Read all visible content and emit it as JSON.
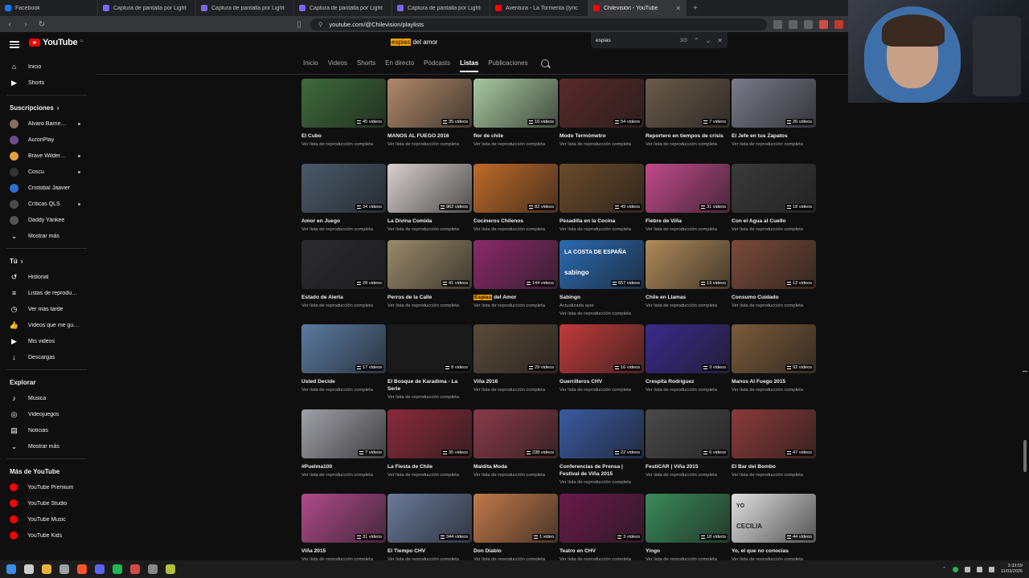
{
  "browser": {
    "tabs": [
      {
        "label": "Facebook",
        "color": "#1877f2",
        "active": false
      },
      {
        "label": "Captura de pantalla por Lightshot",
        "color": "#7b68ee",
        "active": false
      },
      {
        "label": "Captura de pantalla por Lightshot",
        "color": "#7b68ee",
        "active": false
      },
      {
        "label": "Captura de pantalla por Lightshot",
        "color": "#7b68ee",
        "active": false
      },
      {
        "label": "Captura de pantalla por Lightshot",
        "color": "#7b68ee",
        "active": false
      },
      {
        "label": "Aventura - La Tormenta (lyric - letra)",
        "color": "#ff0000",
        "active": false
      },
      {
        "label": "Chilevisión - YouTube",
        "color": "#ff0000",
        "active": true
      }
    ],
    "url": "youtube.com/@Chilevision/playlists",
    "find": {
      "query": "espias",
      "count": "3/3"
    }
  },
  "youtube": {
    "logo_text": "YouTube",
    "country_code": "CL",
    "search_highlight": "espias",
    "search_rest": " del amor",
    "channel_tabs": [
      "Inicio",
      "Videos",
      "Shorts",
      "En directo",
      "Pódcasts",
      "Listas",
      "Publicaciones"
    ],
    "active_tab": "Listas"
  },
  "sidebar": {
    "main": [
      {
        "label": "Inicio",
        "icon": "home-icon",
        "glyph": "⌂"
      },
      {
        "label": "Shorts",
        "icon": "shorts-icon",
        "glyph": "▶"
      }
    ],
    "subscriptions_title": "Suscripciones",
    "subscriptions": [
      {
        "label": "Alvaro Barriento...",
        "color": "#8a6d5a",
        "dot": true
      },
      {
        "label": "AuronPlay",
        "color": "#6d4c8a",
        "dot": false
      },
      {
        "label": "Brave Wilderness",
        "color": "#e2a03a",
        "dot": true
      },
      {
        "label": "Coscu",
        "color": "#333333",
        "dot": true
      },
      {
        "label": "Cristobal Jaavier",
        "color": "#2e6fd1",
        "dot": false
      },
      {
        "label": "Críticas QLS",
        "color": "#4a4a4a",
        "dot": true
      },
      {
        "label": "Daddy Yankee",
        "color": "#555555",
        "dot": false
      }
    ],
    "show_more": "Mostrar más",
    "you_title": "Tú",
    "you": [
      {
        "label": "Historial",
        "icon": "history-icon",
        "glyph": "↺"
      },
      {
        "label": "Listas de reproducc...",
        "icon": "playlists-icon",
        "glyph": "≡"
      },
      {
        "label": "Ver más tarde",
        "icon": "watch-later-icon",
        "glyph": "◷"
      },
      {
        "label": "Videos que me gus...",
        "icon": "liked-icon",
        "glyph": "👍"
      },
      {
        "label": "Mis videos",
        "icon": "my-videos-icon",
        "glyph": "▶"
      },
      {
        "label": "Descargas",
        "icon": "downloads-icon",
        "glyph": "↓"
      }
    ],
    "explore_title": "Explorar",
    "explore": [
      {
        "label": "Música",
        "icon": "music-icon",
        "glyph": "♪"
      },
      {
        "label": "Videojuegos",
        "icon": "gaming-icon",
        "glyph": "◎"
      },
      {
        "label": "Noticias",
        "icon": "news-icon",
        "glyph": "▤"
      }
    ],
    "explore_more": "Mostrar más",
    "more_title": "Más de YouTube",
    "more": [
      {
        "label": "YouTube Premium"
      },
      {
        "label": "YouTube Studio"
      },
      {
        "label": "YouTube Music"
      },
      {
        "label": "YouTube Kids"
      }
    ]
  },
  "playlists": [
    [
      {
        "title": "El Cubo",
        "count": "45 videos",
        "sub": "Ver lista de reproducción completa",
        "color": "#3d6b3a"
      },
      {
        "title": "MANOS AL FUEGO 2016",
        "count": "35 videos",
        "sub": "Ver lista de reproducción completa",
        "color": "#b08a6a"
      },
      {
        "title": "flor de chile",
        "count": "16 videos",
        "sub": "Ver lista de reproducción completa",
        "color": "#a8c8a0"
      },
      {
        "title": "Modo Termómetro",
        "count": "54 videos",
        "sub": "Ver lista de reproducción completa",
        "color": "#5a2a2a"
      },
      {
        "title": "Reportero en tiempos de crisis",
        "count": "7 videos",
        "sub": "Ver lista de reproducción completa",
        "color": "#6a5a4a"
      },
      {
        "title": "El Jefe en tus Zapatos",
        "count": "26 videos",
        "sub": "Ver lista de reproducción completa",
        "color": "#7a7a8a"
      }
    ],
    [
      {
        "title": "Amor en Juego",
        "count": "34 videos",
        "sub": "Ver lista de reproducción completa",
        "color": "#4a5a6a"
      },
      {
        "title": "La Divina Comida",
        "count": "962 videos",
        "sub": "Ver lista de reproducción completa",
        "color": "#d8d0d0"
      },
      {
        "title": "Cocineros Chilenos",
        "count": "82 videos",
        "sub": "Ver lista de reproducción completa",
        "color": "#c06a2a"
      },
      {
        "title": "Pesadilla en la Cocina",
        "count": "49 videos",
        "sub": "Ver lista de reproducción completa",
        "color": "#6a4a2a"
      },
      {
        "title": "Fiebre de Viña",
        "count": "31 videos",
        "sub": "Ver lista de reproducción completa",
        "color": "#c04a8a"
      },
      {
        "title": "Con el Agua al Cuello",
        "count": "18 videos",
        "sub": "Ver lista de reproducción completa",
        "color": "#3a3a3a"
      }
    ],
    [
      {
        "title": "Estado de Alerta",
        "count": "28 videos",
        "sub": "Ver lista de reproducción completa",
        "color": "#2a2a30"
      },
      {
        "title": "Perros de la Calle",
        "count": "41 videos",
        "sub": "Ver lista de reproducción completa",
        "color": "#9a8a6a"
      },
      {
        "title": "Espías del Amor",
        "title_hl": "Espías",
        "title_rest": " del Amor",
        "count": "144 videos",
        "sub": "Ver lista de reproducción completa",
        "color": "#8a2a6a"
      },
      {
        "title": "Sabingo",
        "count": "657 videos",
        "sub": "Actualizada ayer",
        "sub2": "Ver lista de reproducción completa",
        "color": "#2a6ab0",
        "overlay_top": "LA COSTA DE ESPAÑA",
        "overlay_bottom": "sabingo"
      },
      {
        "title": "Chile en Llamas",
        "count": "13 videos",
        "sub": "Ver lista de reproducción completa",
        "color": "#b08a5a"
      },
      {
        "title": "Consumo Cuidado",
        "count": "12 videos",
        "sub": "Ver lista de reproducción completa",
        "color": "#7a4a3a"
      }
    ],
    [
      {
        "title": "Usted Decide",
        "count": "17 videos",
        "sub": "Ver lista de reproducción completa",
        "color": "#5a7aa0"
      },
      {
        "title": "El Bosque de Karadima - La Serie",
        "count": "8 videos",
        "sub": "Ver lista de reproducción completa",
        "color": "#1a1a1a"
      },
      {
        "title": "Viña 2016",
        "count": "29 videos",
        "sub": "Ver lista de reproducción completa",
        "color": "#5a4a3a"
      },
      {
        "title": "Guerrilleros CHV",
        "count": "16 videos",
        "sub": "Ver lista de reproducción completa",
        "color": "#c03a3a"
      },
      {
        "title": "Crespita Rodríguez",
        "count": "3 videos",
        "sub": "Ver lista de reproducción completa",
        "color": "#3a2a8a"
      },
      {
        "title": "Manos Al Fuego 2015",
        "count": "92 videos",
        "sub": "Ver lista de reproducción completa",
        "color": "#7a5a3a"
      }
    ],
    [
      {
        "title": "#Puelma100",
        "count": "7 videos",
        "sub": "Ver lista de reproducción completa",
        "color": "#a0a0a8"
      },
      {
        "title": "La Fiesta de Chile",
        "count": "35 videos",
        "sub": "Ver lista de reproducción completa",
        "color": "#8a2a3a"
      },
      {
        "title": "Maldita Moda",
        "count": "238 videos",
        "sub": "Ver lista de reproducción completa",
        "color": "#8a3a4a"
      },
      {
        "title": "Conferencias de Prensa | Festival de Viña 2015",
        "count": "22 videos",
        "sub": "Ver lista de reproducción completa",
        "color": "#3a5aa0"
      },
      {
        "title": "FestiCAR | Viña 2015",
        "count": "6 videos",
        "sub": "Ver lista de reproducción completa",
        "color": "#4a4a4a"
      },
      {
        "title": "El Bar del Bombo",
        "count": "47 videos",
        "sub": "Ver lista de reproducción completa",
        "color": "#8a3a3a"
      }
    ],
    [
      {
        "title": "Viña 2015",
        "count": "31 videos",
        "sub": "Ver lista de reproducción completa",
        "color": "#b04a8a"
      },
      {
        "title": "El Tiempo CHV",
        "count": "344 videos",
        "sub": "Ver lista de reproducción completa",
        "color": "#6a7a9a"
      },
      {
        "title": "Don Diablo",
        "count": "1 video",
        "sub": "Ver lista de reproducción completa",
        "color": "#c07a4a"
      },
      {
        "title": "Teatro en CHV",
        "count": "3 videos",
        "sub": "Ver lista de reproducción completa",
        "color": "#6a1a4a"
      },
      {
        "title": "Yingo",
        "count": "18 videos",
        "sub": "Ver lista de reproducción completa",
        "color": "#3a8a5a"
      },
      {
        "title": "Yo, el que no conocías",
        "count": "44 videos",
        "sub": "Ver lista de reproducción completa",
        "color": "#e0e0e0",
        "overlay_top": "YO",
        "overlay_bottom": "CECILIA"
      }
    ]
  ],
  "taskbar": {
    "icons": [
      {
        "name": "windows-start-icon",
        "color": "#3a8ee6"
      },
      {
        "name": "search-icon",
        "color": "#cccccc"
      },
      {
        "name": "file-explorer-icon",
        "color": "#e8b23a"
      },
      {
        "name": "chrome-icon",
        "color": "#9aa0a6"
      },
      {
        "name": "brave-icon",
        "color": "#fb542b"
      },
      {
        "name": "discord-icon",
        "color": "#5865f2"
      },
      {
        "name": "spotify-icon",
        "color": "#1db954"
      },
      {
        "name": "app-icon",
        "color": "#d04a4a"
      },
      {
        "name": "obs-icon",
        "color": "#888888"
      },
      {
        "name": "app2-icon",
        "color": "#b0c040"
      }
    ],
    "time": "3:33:59",
    "date": "11/03/2026"
  }
}
